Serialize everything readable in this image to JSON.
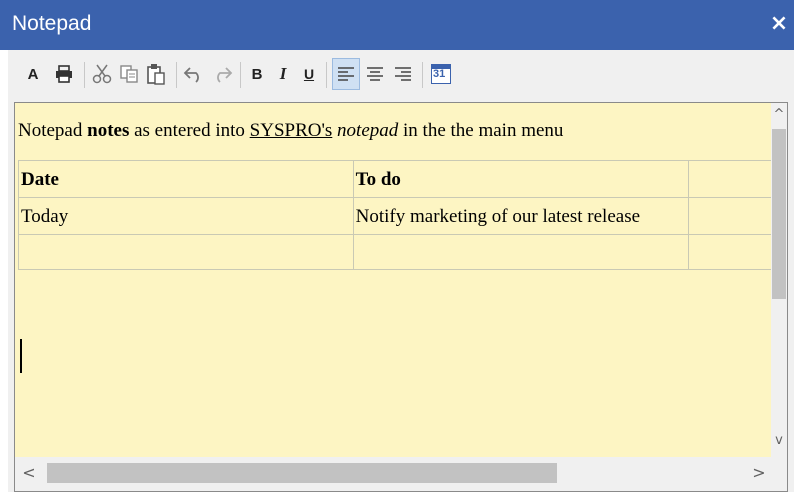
{
  "window": {
    "title": "Notepad",
    "close_glyph": "×"
  },
  "toolbar": {
    "font": {
      "label": "A",
      "icon": "font-icon"
    },
    "print": {
      "icon": "printer-icon"
    },
    "cut": {
      "icon": "scissors-icon"
    },
    "copy": {
      "icon": "copy-icon"
    },
    "paste": {
      "icon": "paste-icon"
    },
    "undo": {
      "icon": "undo-icon"
    },
    "redo": {
      "icon": "redo-icon"
    },
    "bold": {
      "label": "B"
    },
    "italic": {
      "label": "I"
    },
    "underline": {
      "label": "U"
    },
    "align_left": {
      "icon": "align-left-icon",
      "active": true
    },
    "align_center": {
      "icon": "align-center-icon"
    },
    "align_right": {
      "icon": "align-right-icon"
    },
    "date": {
      "label": "31",
      "icon": "calendar-icon"
    }
  },
  "document": {
    "paragraph": {
      "part1": "Notepad ",
      "bold": "notes",
      "part2": " as entered into ",
      "underline": "SYSPRO's",
      "part3": " ",
      "italic": "notepad",
      "part4": " in the the main menu"
    },
    "table": {
      "headers": [
        "Date",
        "To do",
        ""
      ],
      "rows": [
        [
          "Today",
          "Notify marketing of our latest release",
          ""
        ],
        [
          "",
          "",
          ""
        ]
      ]
    }
  },
  "scrollbars": {
    "up": "^",
    "down": "v",
    "left": "<",
    "right": ">"
  },
  "colors": {
    "titlebar": "#3b62ad",
    "editor_background": "#fdf5c3",
    "active_button": "#cfe0f3"
  }
}
